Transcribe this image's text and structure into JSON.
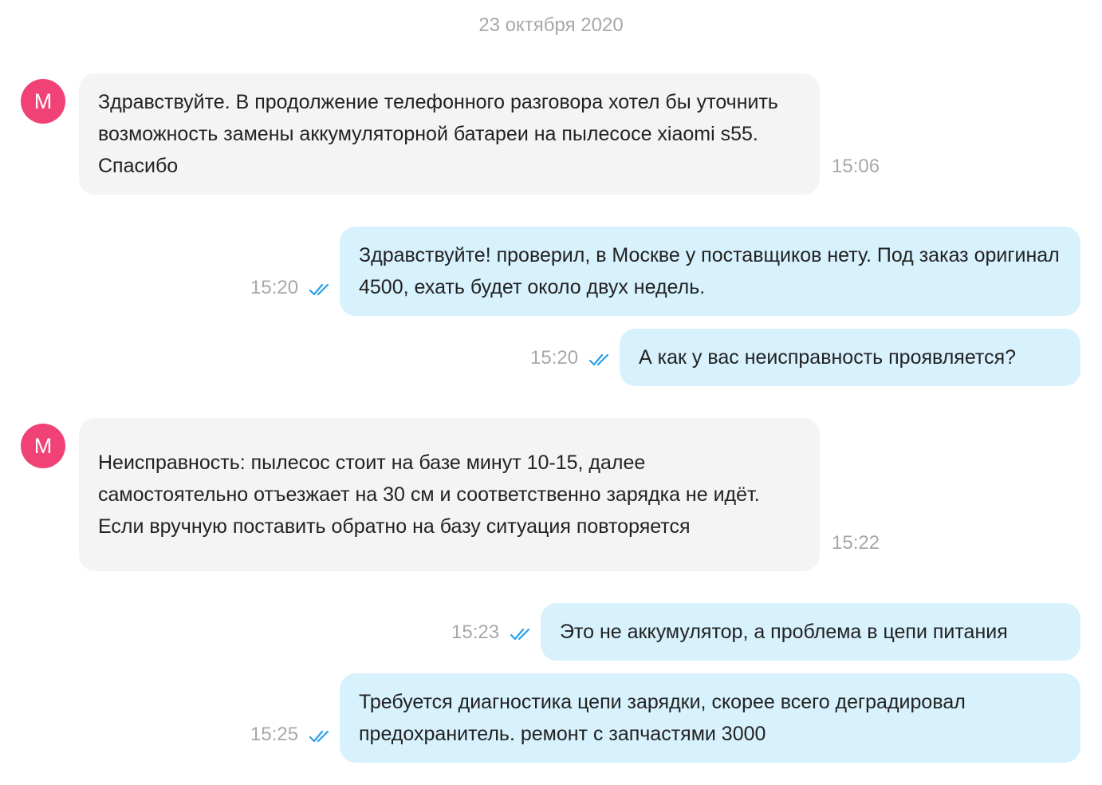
{
  "chat": {
    "date": "23 октября 2020",
    "avatar_letter": "M",
    "messages": [
      {
        "direction": "incoming",
        "text": "Здравствуйте. В продолжение телефонного разговора хотел бы уточнить возможность замены аккумуляторной батареи на пылесосе xiaomi s55. Спасибо",
        "time": "15:06"
      },
      {
        "direction": "outgoing",
        "text": "Здравствуйте! проверил, в Москве у поставщиков нету. Под заказ оригинал 4500, ехать будет около двух недель.",
        "time": "15:20",
        "read": true
      },
      {
        "direction": "outgoing",
        "text": "А как у вас неисправность проявляется?",
        "time": "15:20",
        "read": true
      },
      {
        "direction": "incoming",
        "text": "Неисправность: пылесос стоит на базе минут 10-15, далее самостоятельно отъезжает на 30 см и соответственно зарядка не идёт. Если вручную поставить обратно на базу ситуация повторяется",
        "time": "15:22"
      },
      {
        "direction": "outgoing",
        "text": "Это не аккумулятор, а проблема в цепи питания",
        "time": "15:23",
        "read": true
      },
      {
        "direction": "outgoing",
        "text": "Требуется диагностика цепи зарядки, скорее всего деградировал предохранитель. ремонт с запчастями 3000",
        "time": "15:25",
        "read": true
      }
    ]
  },
  "colors": {
    "avatar": "#f04277",
    "incoming_bubble": "#f4f4f4",
    "outgoing_bubble": "#d7f1fd",
    "read_ticks": "#2a9fe8",
    "meta_text": "#a8a8a8"
  },
  "icons": {
    "read_status": "double-check-icon"
  }
}
